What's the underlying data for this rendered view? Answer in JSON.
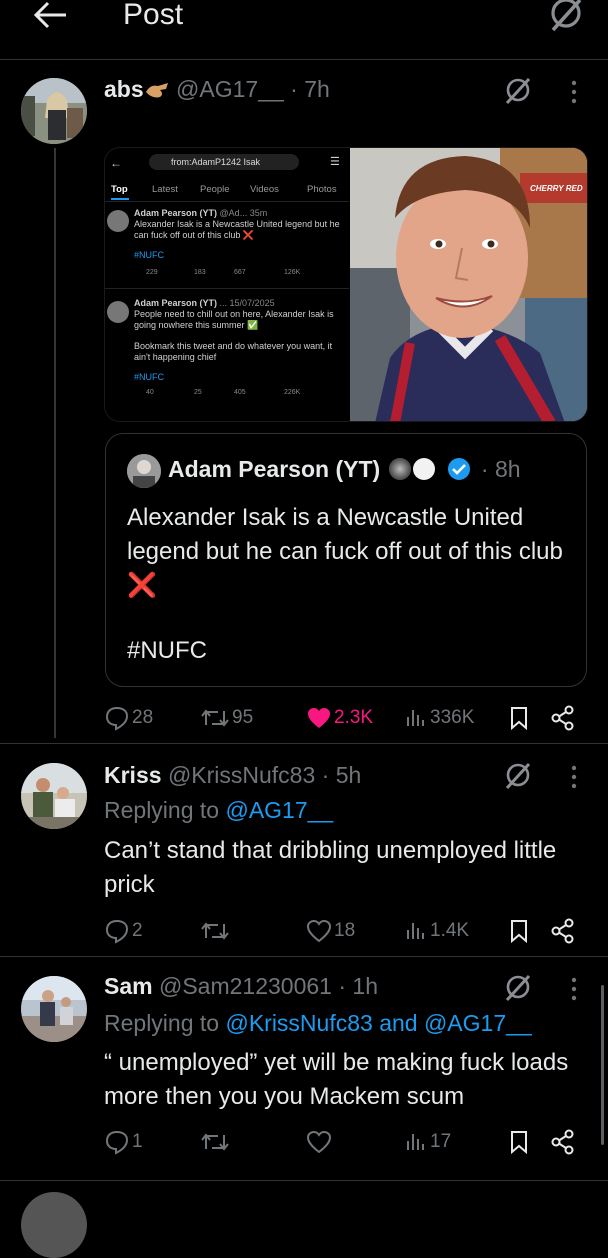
{
  "header": {
    "title": "Post",
    "back_icon": "arrow-left-icon",
    "grok_icon": "grok-icon"
  },
  "main_post": {
    "display_name": "abs",
    "handle": "@AG17__",
    "time": "7h",
    "screenshot": {
      "search": "from:AdamP1242 Isak",
      "tabs": [
        "Top",
        "Latest",
        "People",
        "Videos",
        "Photos"
      ],
      "tweet1": {
        "name": "Adam Pearson (YT)",
        "handle_time": "@Ad... 35m",
        "text": "Alexander Isak is a Newcastle United legend but he can fuck off out of this club ❌",
        "hashtag": "#NUFC",
        "stats": [
          "229",
          "183",
          "667",
          "126K"
        ]
      },
      "tweet2": {
        "name": "Adam Pearson (YT)",
        "handle_time": "... 15/07/2025",
        "text": "People need to chill out on here, Alexander Isak is going nowhere this summer ✅",
        "text2": "Bookmark this tweet and do whatever you want, it ain't happening chief",
        "hashtag": "#NUFC",
        "stats": [
          "40",
          "25",
          "405",
          "226K"
        ]
      }
    },
    "photo_sign": "CHERRY RED",
    "quote": {
      "display_name": "Adam Pearson (YT)",
      "time": "8h",
      "text": "Alexander Isak is a Newcastle United legend but he can fuck off out of this club ❌",
      "hashtag": "#NUFC"
    },
    "stats": {
      "replies": "28",
      "reposts": "95",
      "likes": "2.3K",
      "views": "336K"
    }
  },
  "replies": [
    {
      "display_name": "Kriss",
      "handle": "@KrissNufc83",
      "time": "5h",
      "replying_label": "Replying to",
      "replying_to": "@AG17__",
      "text": "Can’t stand that dribbling unemployed little prick",
      "stats": {
        "replies": "2",
        "reposts": "",
        "likes": "18",
        "views": "1.4K"
      }
    },
    {
      "display_name": "Sam",
      "handle": "@Sam21230061",
      "time": "1h",
      "replying_label": "Replying to",
      "replying_to": "@KrissNufc83 and @AG17__",
      "text": "“ unemployed” yet will be making fuck loads more then you you Mackem scum",
      "stats": {
        "replies": "1",
        "reposts": "",
        "likes": "",
        "views": "17"
      }
    }
  ],
  "colors": {
    "background": "#000000",
    "text": "#e7e9ea",
    "muted": "#71767b",
    "link": "#1d9bf0",
    "like": "#f91880"
  }
}
